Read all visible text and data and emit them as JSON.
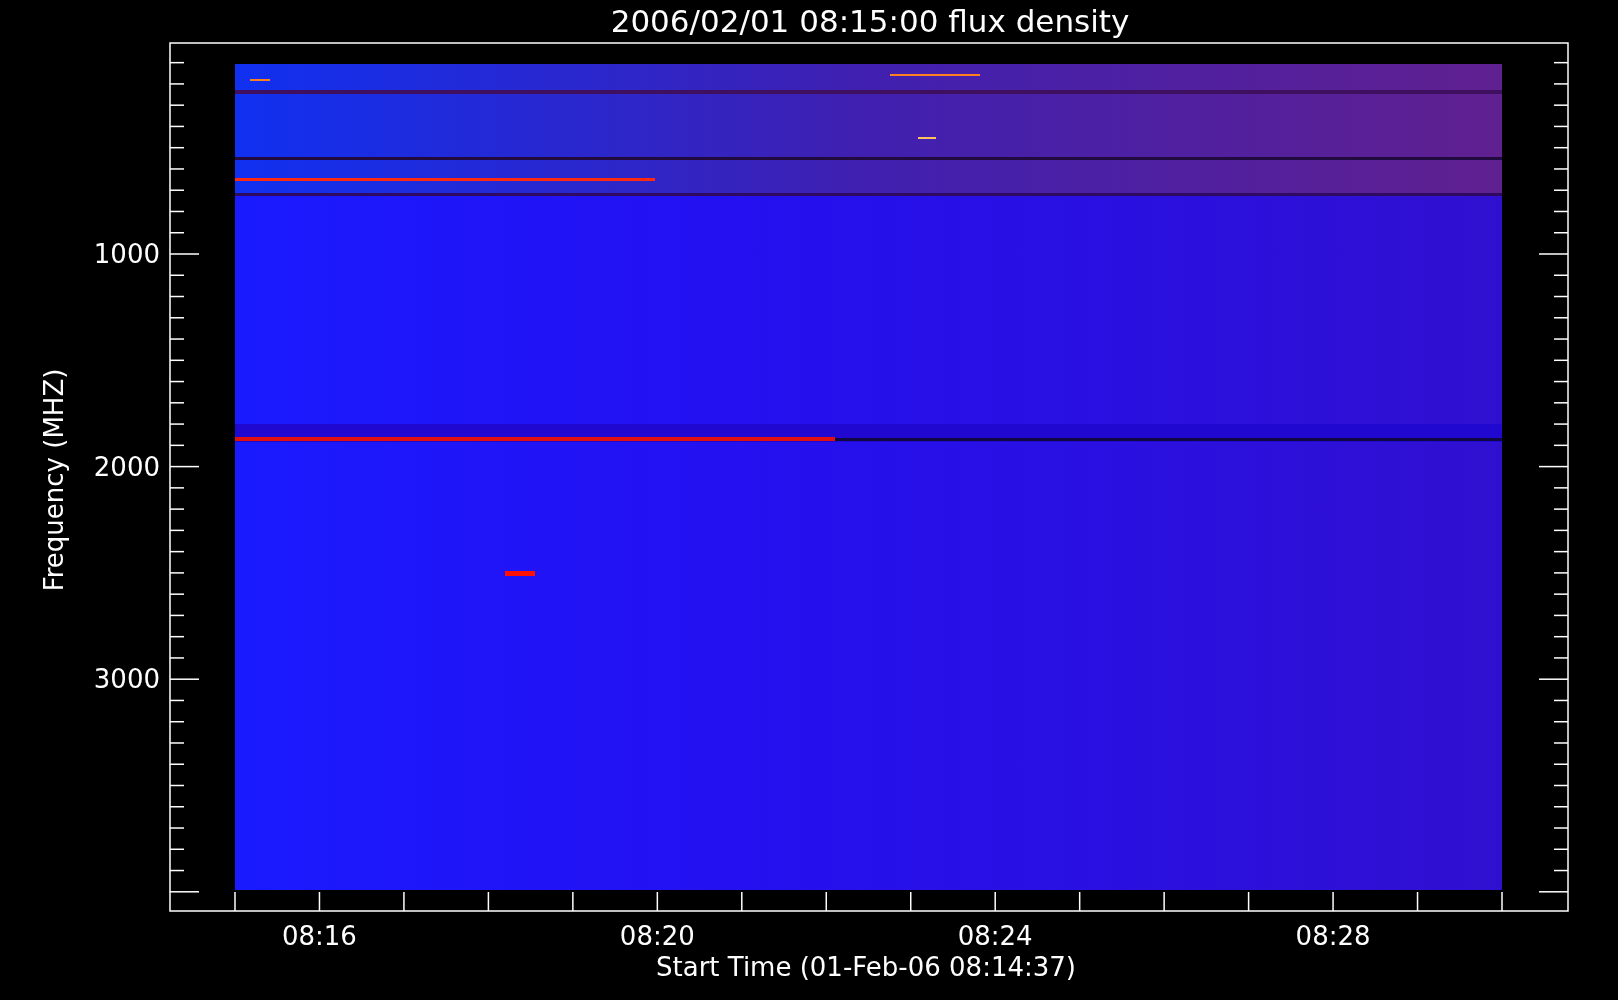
{
  "plot": {
    "title": "2006/02/01 08:15:00 flux density",
    "xlabel": "Start Time (01-Feb-06 08:14:37)",
    "ylabel": "Frequency (MHZ)",
    "xtick_labels": [
      "08:16",
      "08:20",
      "08:24",
      "08:28"
    ],
    "ytick_labels": [
      "1000",
      "2000",
      "3000"
    ]
  }
}
